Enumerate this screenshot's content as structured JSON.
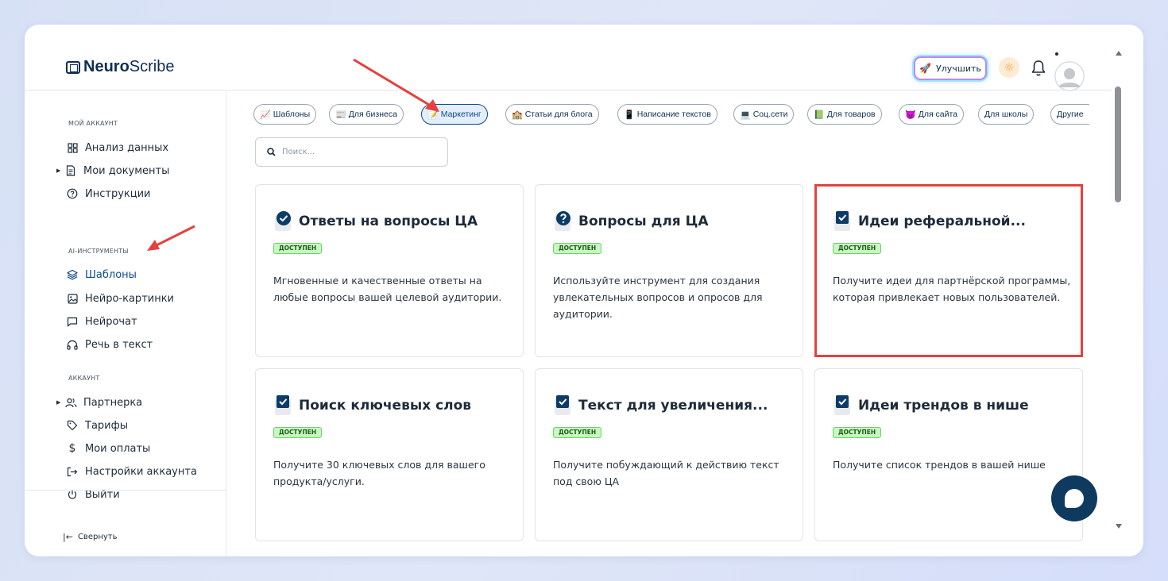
{
  "app": {
    "logo_bold": "Neuro",
    "logo_light": "Scribe"
  },
  "header": {
    "upgrade_label": "Улучшить"
  },
  "sidebar": {
    "section_account": "МОЙ АККАУНТ",
    "section_ai": "AI-ИНСТРУМЕНТЫ",
    "section_profile": "АККАУНТ",
    "items": [
      {
        "label": "Анализ данных"
      },
      {
        "label": "Мои документы"
      },
      {
        "label": "Инструкции"
      },
      {
        "label": "Шаблоны"
      },
      {
        "label": "Нейро-картинки"
      },
      {
        "label": "Нейрочат"
      },
      {
        "label": "Речь в текст"
      },
      {
        "label": "Партнерка"
      },
      {
        "label": "Тарифы"
      },
      {
        "label": "Мои оплаты"
      },
      {
        "label": "Настройки аккаунта"
      },
      {
        "label": "Выйти"
      }
    ],
    "collapse_label": "Свернуть"
  },
  "tabs": [
    {
      "label": "Шаблоны",
      "emoji": "📈"
    },
    {
      "label": "Для бизнеса",
      "emoji": "📰"
    },
    {
      "label": "Маркетинг",
      "emoji": "📝"
    },
    {
      "label": "Статьи для блога",
      "emoji": "🏫"
    },
    {
      "label": "Написание текстов",
      "emoji": "📱"
    },
    {
      "label": "Соц.сети",
      "emoji": "💻"
    },
    {
      "label": "Для товаров",
      "emoji": "📗"
    },
    {
      "label": "Для сайта",
      "emoji": "😈"
    },
    {
      "label": "Для школы",
      "emoji": ""
    },
    {
      "label": "Другие",
      "emoji": ""
    }
  ],
  "search": {
    "placeholder": "Поиск..."
  },
  "cards": [
    {
      "title": "Ответы на вопросы ЦА",
      "badge": "ДОСТУПЕН",
      "desc": "Мгновенные и качественные ответы на любые вопросы вашей целевой аудитории.",
      "icon": "check-circle-icon"
    },
    {
      "title": "Вопросы для ЦА",
      "badge": "ДОСТУПЕН",
      "desc": "Используйте инструмент для создания увлекательных вопросов и опросов для аудитории.",
      "icon": "question-circle-icon"
    },
    {
      "title": "Идеи реферальной...",
      "badge": "ДОСТУПЕН",
      "desc": "Получите идеи для партнёрской программы, которая привлекает новых пользователей.",
      "icon": "checkbox-icon"
    },
    {
      "title": "Поиск ключевых слов",
      "badge": "ДОСТУПЕН",
      "desc": "Получите 30 ключевых слов для вашего продукта/услуги.",
      "icon": "checkbox-icon"
    },
    {
      "title": "Текст для увеличения...",
      "badge": "ДОСТУПЕН",
      "desc": "Получите побуждающий к действию текст под свою ЦА",
      "icon": "checkbox-icon"
    },
    {
      "title": "Идеи трендов в нише",
      "badge": "ДОСТУПЕН",
      "desc": "Получите список трендов в вашей нише",
      "icon": "checkbox-icon"
    }
  ],
  "colors": {
    "brand": "#0d2f52",
    "accent": "#0d4b8a",
    "badge_bg": "#c8f7c2",
    "highlight": "#e5413e",
    "annotation_arrow": "#e5413e"
  }
}
